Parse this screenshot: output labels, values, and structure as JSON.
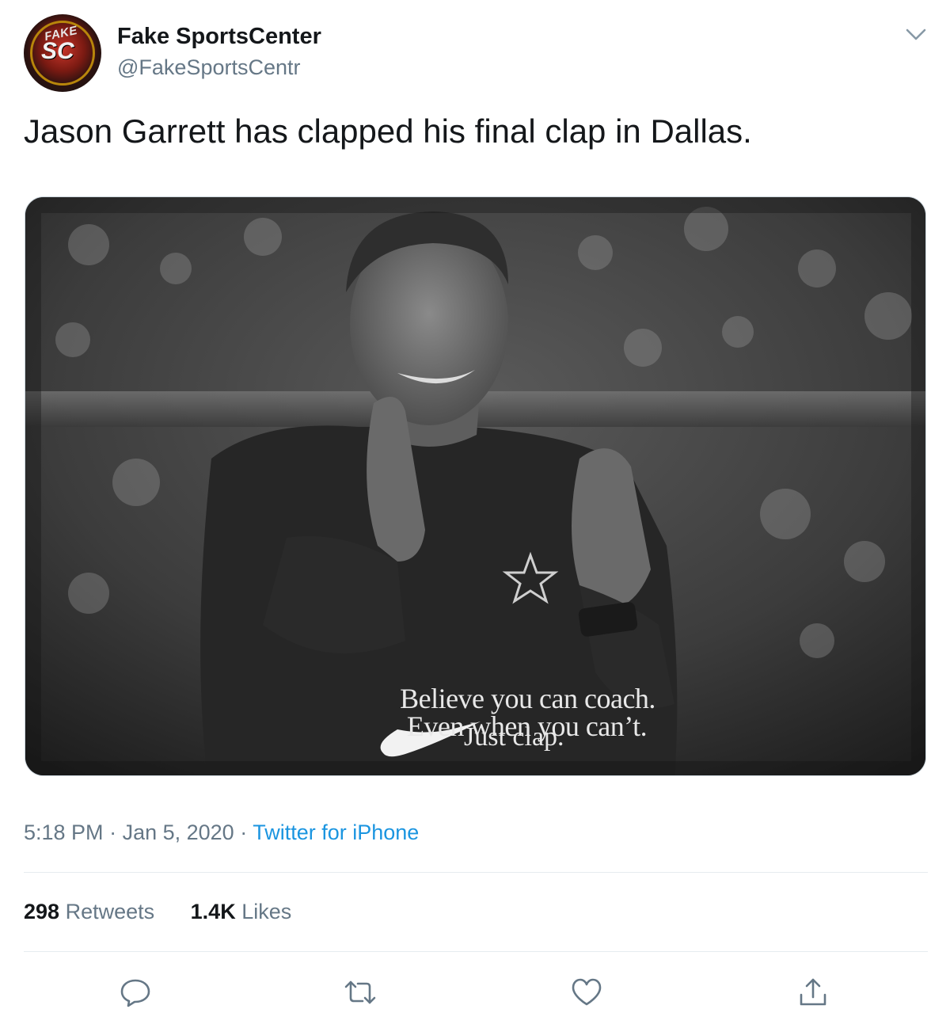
{
  "user": {
    "display_name": "Fake SportsCenter",
    "handle": "@FakeSportsCentr",
    "avatar_text_top": "FAKE",
    "avatar_text_main": "SC"
  },
  "tweet": {
    "text": "Jason Garrett has clapped his final clap in Dallas."
  },
  "media": {
    "line1": "Believe you can coach.",
    "line2": "Even when you can’t.",
    "tagline": "Just clap."
  },
  "meta": {
    "time": "5:18 PM",
    "sep1": " · ",
    "date": "Jan 5, 2020",
    "sep2": " · ",
    "source": "Twitter for iPhone"
  },
  "stats": {
    "retweets_count": "298",
    "retweets_label": "Retweets",
    "likes_count": "1.4K",
    "likes_label": "Likes"
  },
  "icons": {
    "caret": "chevron-down-icon",
    "reply": "reply-icon",
    "retweet": "retweet-icon",
    "like": "heart-icon",
    "share": "share-icon"
  },
  "colors": {
    "link": "#1b95e0",
    "secondary_text": "#657786",
    "icon": "#657786",
    "divider": "#e6ecf0"
  }
}
